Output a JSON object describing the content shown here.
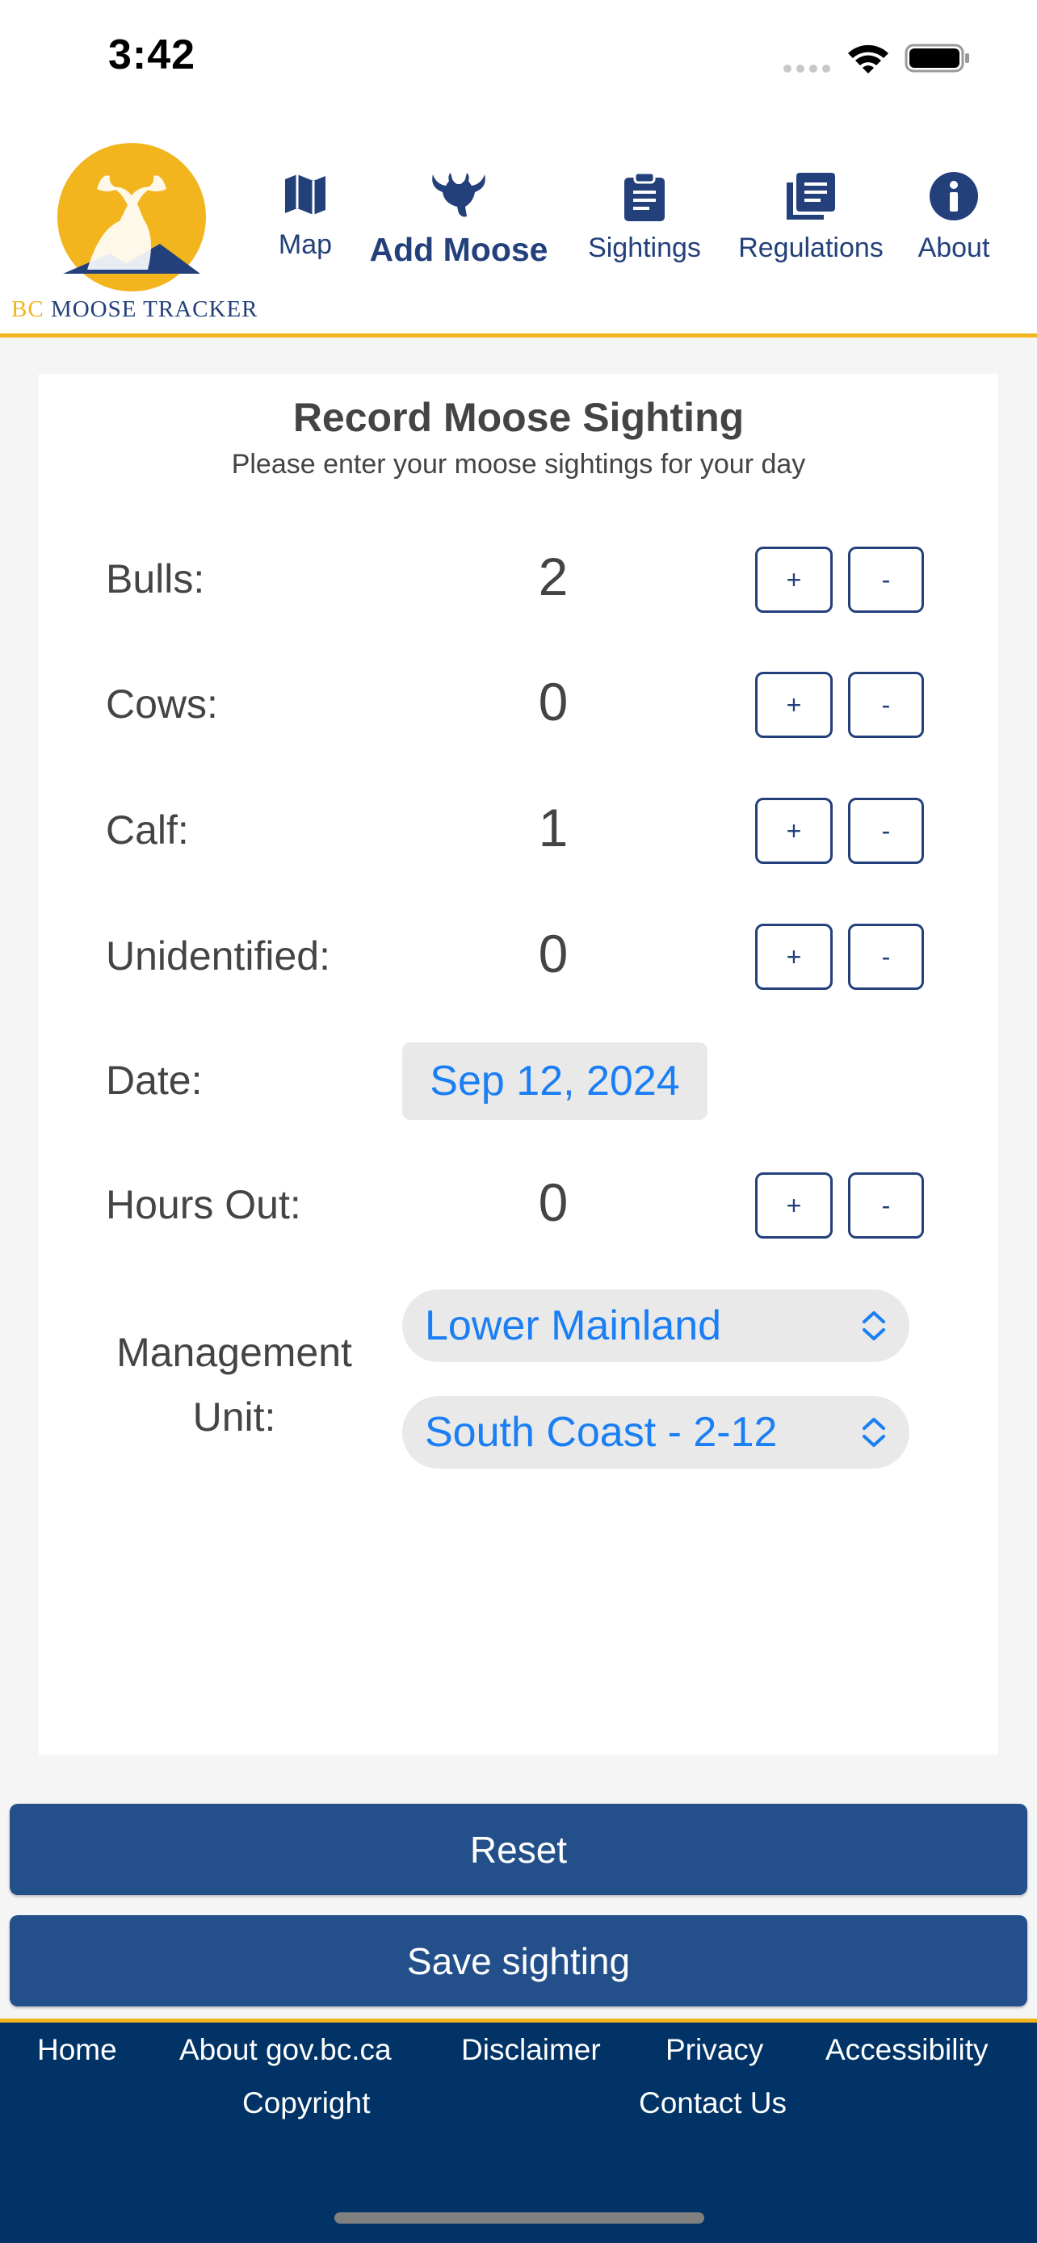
{
  "status_bar": {
    "time": "3:42"
  },
  "app": {
    "logo_text_bc": "BC",
    "logo_text_rest": " MOOSE TRACKER"
  },
  "nav": [
    {
      "label": "Map",
      "icon": "map-icon"
    },
    {
      "label": "Add Moose",
      "icon": "moose-icon",
      "active": true
    },
    {
      "label": "Sightings",
      "icon": "clipboard-icon"
    },
    {
      "label": "Regulations",
      "icon": "book-icon"
    },
    {
      "label": "About",
      "icon": "info-icon"
    }
  ],
  "form": {
    "title": "Record Moose Sighting",
    "subtitle": "Please enter your moose sightings for your day",
    "plus_label": "+",
    "minus_label": "-",
    "rows": [
      {
        "label": "Bulls:",
        "value": "2"
      },
      {
        "label": "Cows:",
        "value": "0"
      },
      {
        "label": "Calf:",
        "value": "1"
      },
      {
        "label": "Unidentified:",
        "value": "0"
      }
    ],
    "date": {
      "label": "Date:",
      "value": "Sep 12, 2024"
    },
    "hours": {
      "label": "Hours Out:",
      "value": "0"
    },
    "management": {
      "label_line1": "Management",
      "label_line2": "Unit:",
      "region": "Lower Mainland",
      "unit": "South Coast - 2-12"
    }
  },
  "buttons": {
    "reset": "Reset",
    "save": "Save sighting"
  },
  "footer": {
    "links": [
      "Home",
      "About gov.bc.ca",
      "Disclaimer",
      "Privacy",
      "Accessibility",
      "Copyright",
      "Contact Us"
    ]
  },
  "colors": {
    "primary": "#23508b",
    "nav_text": "#23407a",
    "accent": "#f2b51e",
    "link_blue": "#1a7ef5",
    "footer_bg": "#013366"
  }
}
